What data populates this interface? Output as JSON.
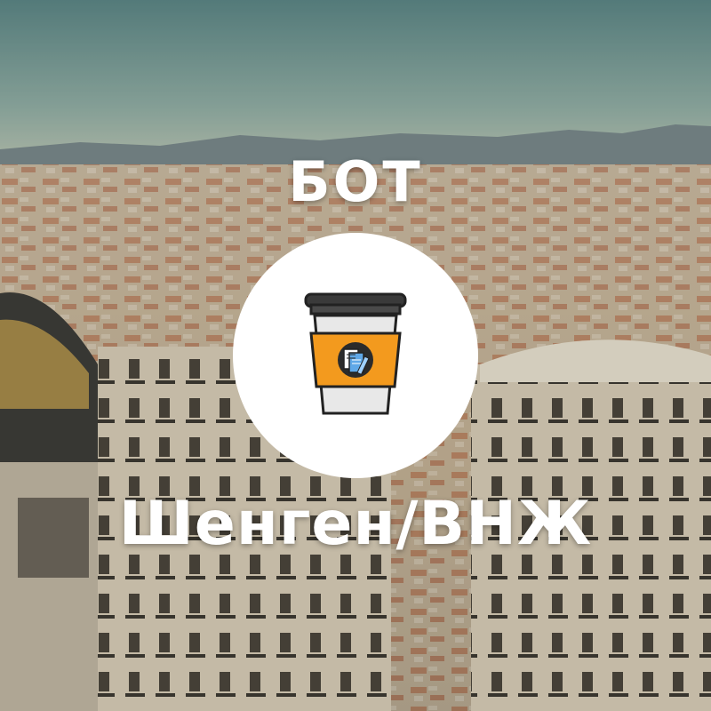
{
  "banner": {
    "title_top": "БОТ",
    "title_bottom": "Шенген/ВНЖ"
  },
  "colors": {
    "text": "#ffffff",
    "circle": "#ffffff",
    "cup_lid": "#3a3a3a",
    "cup_sleeve": "#f39a1e",
    "cup_body": "#e8e8e8"
  },
  "icons": {
    "logo": "coffee-cup-document-icon",
    "background": "city-skyline-photo"
  }
}
